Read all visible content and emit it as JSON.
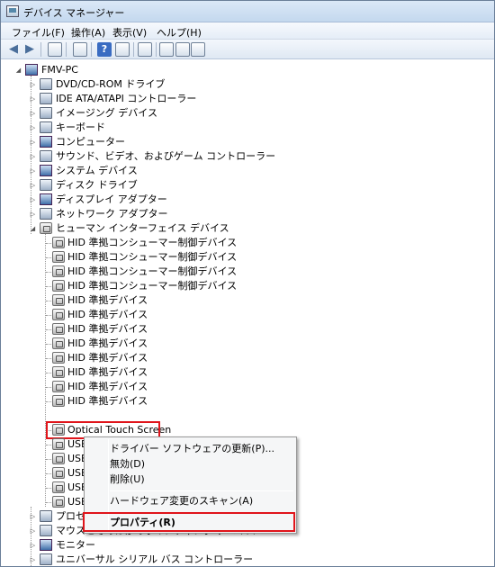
{
  "window": {
    "title": "デバイス マネージャー"
  },
  "menu": [
    "ファイル(F)",
    "操作(A)",
    "表示(V)",
    "ヘルプ(H)"
  ],
  "toolbar": {
    "buttons": [
      "back-arrow-icon",
      "forward-arrow-icon",
      "console-tree-icon",
      "properties-icon",
      "help-icon",
      "details-icon",
      "scan-hardware-icon",
      "update-driver-icon",
      "uninstall-device-icon",
      "disable-device-icon"
    ],
    "help_glyph": "?"
  },
  "tree": {
    "root": "FMV-PC",
    "categories_top": [
      "DVD/CD-ROM ドライブ",
      "IDE ATA/ATAPI コントローラー",
      "イメージング デバイス",
      "キーボード",
      "コンピューター",
      "サウンド、ビデオ、およびゲーム コントローラー",
      "システム デバイス",
      "ディスク ドライブ",
      "ディスプレイ アダプター",
      "ネットワーク アダプター"
    ],
    "expanded_category": "ヒューマン インターフェイス デバイス",
    "hid_children": [
      "HID 準拠コンシューマー制御デバイス",
      "HID 準拠コンシューマー制御デバイス",
      "HID 準拠コンシューマー制御デバイス",
      "HID 準拠コンシューマー制御デバイス",
      "HID 準拠デバイス",
      "HID 準拠デバイス",
      "HID 準拠デバイス",
      "HID 準拠デバイス",
      "HID 準拠デバイス",
      "HID 準拠デバイス",
      "HID 準拠デバイス",
      "HID 準拠デバイス"
    ],
    "selected_child": "Optical Touch Screen",
    "usb_children": [
      "USB",
      "USB",
      "USB",
      "USB",
      "USB"
    ],
    "categories_bottom": [
      "プロセッ",
      "マウスとそのほかのポインティング デバイス",
      "モニター",
      "ユニバーサル シリアル バス コントローラー"
    ]
  },
  "context_menu": {
    "items": [
      "ドライバー ソフトウェアの更新(P)...",
      "無効(D)",
      "削除(U)",
      "ハードウェア変更のスキャン(A)",
      "プロパティ(R)"
    ]
  },
  "colors": {
    "highlight_border": "#e0151b"
  }
}
